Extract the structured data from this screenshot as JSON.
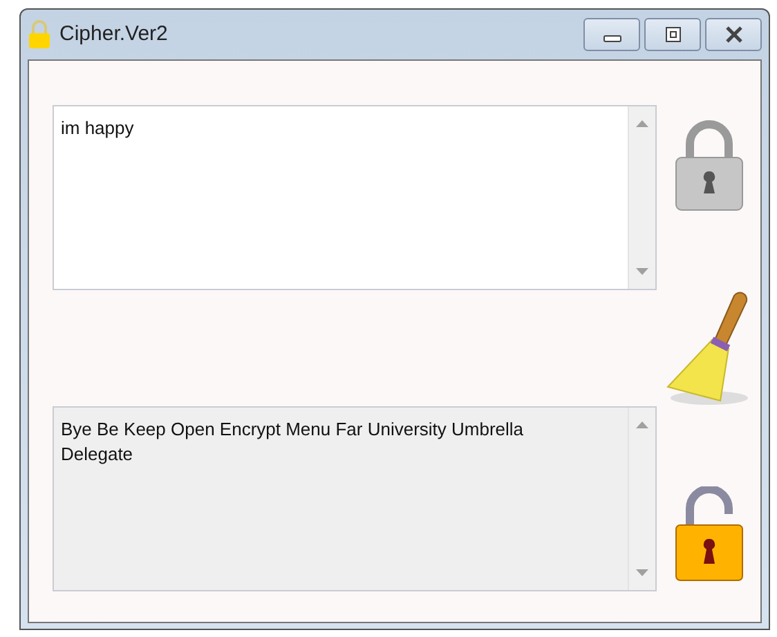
{
  "window": {
    "title": "Cipher.Ver2"
  },
  "input": {
    "value": "im happy",
    "disabled": false
  },
  "output": {
    "value": "Bye Be Keep Open Encrypt Menu Far University Umbrella Delegate",
    "disabled": true
  }
}
